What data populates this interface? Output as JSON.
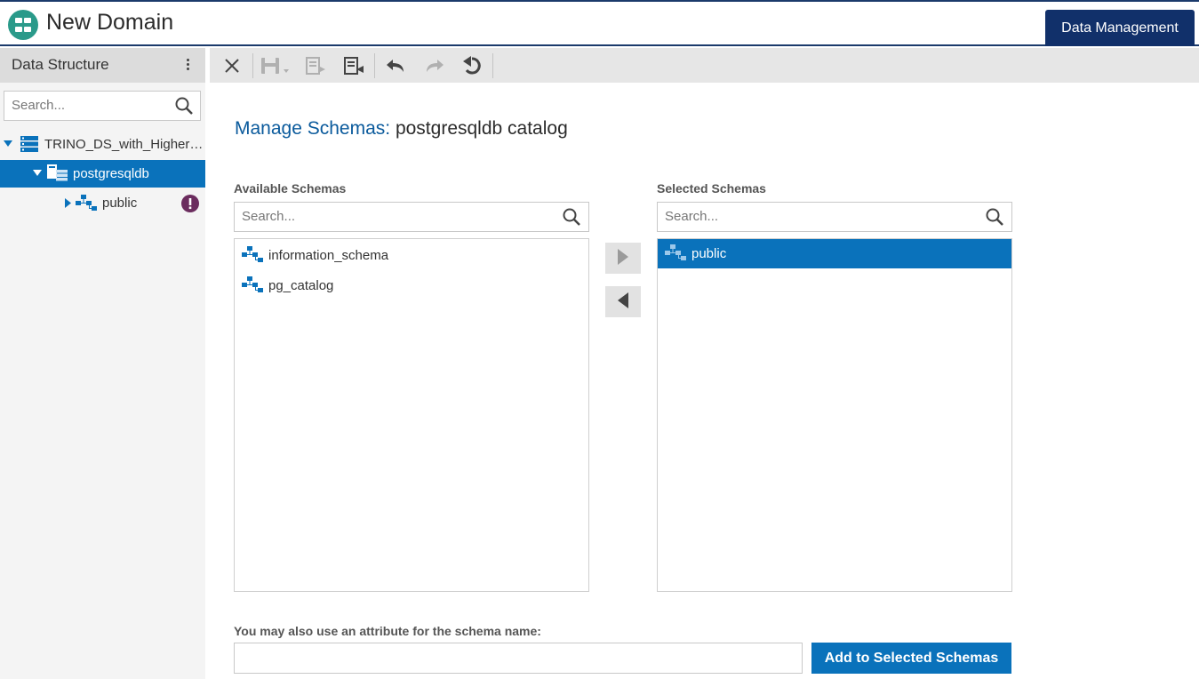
{
  "app": {
    "title": "New Domain",
    "data_management_label": "Data Management"
  },
  "left_panel": {
    "title": "Data Structure",
    "search_placeholder": "Search...",
    "tree": [
      {
        "label": "TRINO_DS_with_Higher…",
        "icon": "datasource-icon",
        "expanded": true
      },
      {
        "label": "postgresqldb",
        "icon": "catalog-icon",
        "expanded": true,
        "selected": true
      },
      {
        "label": "public",
        "icon": "schema-icon",
        "expanded": false,
        "warning": true
      }
    ]
  },
  "toolbar": {
    "buttons": [
      "close-icon",
      "save-icon",
      "export-icon",
      "import-icon",
      "undo-icon",
      "redo-icon",
      "undo-all-icon"
    ]
  },
  "main": {
    "title_label": "Manage Schemas:",
    "title_value": "postgresqldb catalog",
    "available": {
      "label": "Available Schemas",
      "search_placeholder": "Search...",
      "items": [
        "information_schema",
        "pg_catalog"
      ]
    },
    "selected": {
      "label": "Selected Schemas",
      "search_placeholder": "Search...",
      "items": [
        "public"
      ]
    },
    "attribute_label": "You may also use an attribute for the schema name:",
    "attribute_value": "",
    "add_button_label": "Add to Selected Schemas"
  },
  "colors": {
    "accent": "#0a72bb",
    "header_dark": "#11306a",
    "warning": "#6b2c5e"
  }
}
